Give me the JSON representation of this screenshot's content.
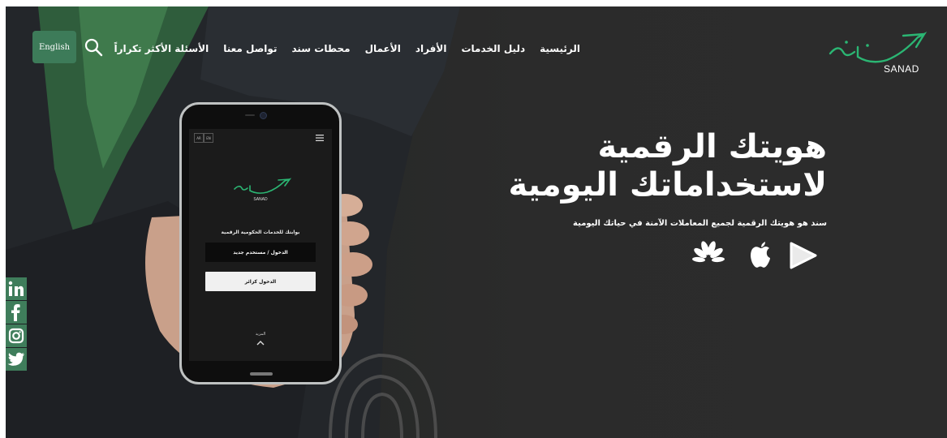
{
  "header": {
    "language_button": "English",
    "nav": [
      "الرئيسية",
      "دليل الخدمات",
      "الأفراد",
      "الأعمال",
      "محطات سند",
      "تواصل معنا",
      "الأسئلة الأكثر تكراراً"
    ],
    "logo_text": "SANAD"
  },
  "hero": {
    "title_line1": "هويتك الرقمية",
    "title_line2": "لاستخداماتك اليومية",
    "subtitle": "سند هو هويتك الرقمية لجميع المعاملات الآمنة في حياتك اليومية",
    "store_icons": [
      "huawei-appgallery-icon",
      "apple-icon",
      "google-play-icon"
    ]
  },
  "phone": {
    "lang_ar": "AR",
    "lang_en": "EN",
    "logo_text": "SANAD",
    "tagline": "بوابتك للخدمات الحكومية الرقمية",
    "login_button": "الدخول / مستخدم جديد",
    "guest_button": "الدخول كزائر",
    "more_label": "المزيد"
  },
  "social": {
    "icons": [
      "linkedin-icon",
      "facebook-icon",
      "instagram-icon",
      "twitter-icon"
    ]
  },
  "colors": {
    "accent": "#3d7b59",
    "logo_green": "#2bb673",
    "background": "#2b2b2b"
  }
}
